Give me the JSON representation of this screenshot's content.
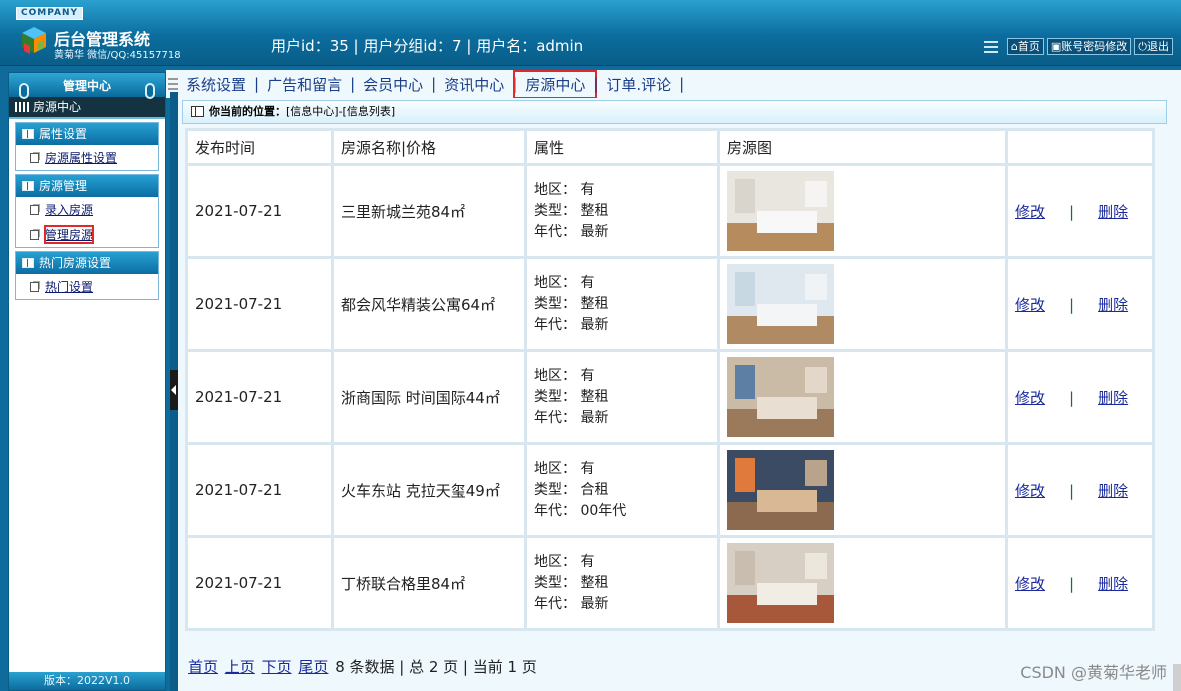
{
  "header": {
    "company_badge": "COMPANY",
    "system_title": "后台管理系统",
    "subtitle": "黄菊华 微信/QQ:45157718",
    "user_info": "用户id：35 | 用户分组id：7 | 用户名：admin",
    "buttons": [
      {
        "label": "首页",
        "icon": "home-icon"
      },
      {
        "label": "账号密码修改",
        "icon": "key-icon"
      },
      {
        "label": "退出",
        "icon": "power-icon"
      }
    ]
  },
  "sidebar": {
    "heading": "管理中心",
    "current": "房源中心",
    "groups": [
      {
        "title": "属性设置",
        "links": [
          "房源属性设置"
        ]
      },
      {
        "title": "房源管理",
        "links": [
          "录入房源",
          "管理房源"
        ]
      },
      {
        "title": "热门房源设置",
        "links": [
          "热门设置"
        ]
      }
    ],
    "version": "版本：2022V1.0"
  },
  "topnav": {
    "items": [
      "系统设置",
      "广告和留言",
      "会员中心",
      "资讯中心",
      "房源中心",
      "订单.评论"
    ],
    "separator": "|",
    "active": "房源中心"
  },
  "breadcrumb": {
    "label": "你当前的位置：",
    "path": "[信息中心]-[信息列表]"
  },
  "table": {
    "headers": [
      "发布时间",
      "房源名称|价格",
      "属性",
      "房源图",
      ""
    ],
    "attr_labels": {
      "region": "地区：",
      "type": "类型：",
      "age": "年代："
    },
    "actions": {
      "edit": "修改",
      "sep": "|",
      "delete": "删除"
    },
    "rows": [
      {
        "date": "2021-07-21",
        "name": "三里新城兰苑84㎡",
        "region": "有",
        "type": "整租",
        "age": "最新",
        "image": "bedroom-photo"
      },
      {
        "date": "2021-07-21",
        "name": "都会风华精装公寓64㎡",
        "region": "有",
        "type": "整租",
        "age": "最新",
        "image": "living-room-photo"
      },
      {
        "date": "2021-07-21",
        "name": "浙商国际 时间国际44㎡",
        "region": "有",
        "type": "整租",
        "age": "最新",
        "image": "studio-photo"
      },
      {
        "date": "2021-07-21",
        "name": "火车东站 克拉天玺49㎡",
        "region": "有",
        "type": "合租",
        "age": "00年代",
        "image": "bedroom-photo"
      },
      {
        "date": "2021-07-21",
        "name": "丁桥联合格里84㎡",
        "region": "有",
        "type": "整租",
        "age": "最新",
        "image": "hallway-photo"
      }
    ]
  },
  "pager": {
    "first": "首页",
    "prev": "上页",
    "next": "下页",
    "last": "尾页",
    "summary": "8 条数据 | 总 2 页 | 当前 1 页"
  },
  "watermark": "CSDN @黄菊华老师",
  "colors": {
    "header": "#0b6d9e",
    "link": "#1a2a9c",
    "highlight": "#e02a2a"
  }
}
